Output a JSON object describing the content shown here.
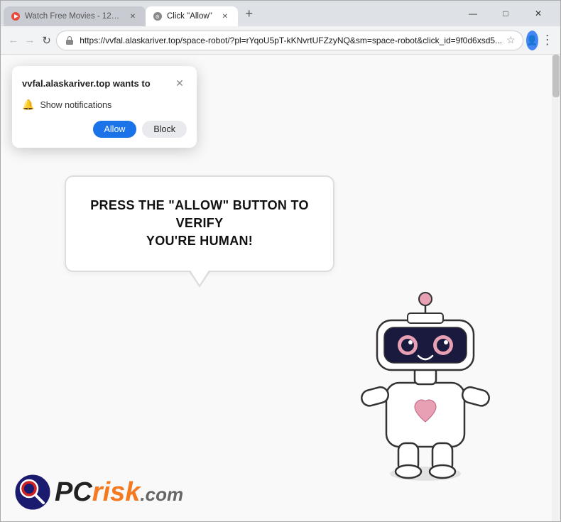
{
  "window": {
    "title": "Click \"Allow\"",
    "controls": {
      "minimize": "—",
      "maximize": "□",
      "close": "✕"
    }
  },
  "tabs": [
    {
      "id": "tab1",
      "label": "Watch Free Movies - 123movie...",
      "favicon": "▶",
      "active": false
    },
    {
      "id": "tab2",
      "label": "Click \"Allow\"",
      "favicon": "⚙",
      "active": true
    }
  ],
  "new_tab_label": "+",
  "nav": {
    "back_icon": "←",
    "forward_icon": "→",
    "refresh_icon": "↻",
    "url": "https://vvfal.alaskariver.top/space-robot/?pl=rYqoU5pT-kKNvrtUFZzyNQ&sm=space-robot&click_id=9f0d6xsd5...",
    "star_icon": "☆",
    "profile_icon": "👤",
    "menu_icon": "⋮"
  },
  "notification_popup": {
    "title": "vvfal.alaskariver.top wants to",
    "close_icon": "✕",
    "bell_icon": "🔔",
    "notification_text": "Show notifications",
    "allow_label": "Allow",
    "block_label": "Block"
  },
  "page": {
    "speech_bubble_text": "PRESS THE \"ALLOW\" BUTTON TO VERIFY\nYOU'RE HUMAN!",
    "robot_alt": "cute robot character"
  },
  "logo": {
    "pc_text": "PC",
    "risk_text": "risk",
    "com_text": ".com"
  }
}
